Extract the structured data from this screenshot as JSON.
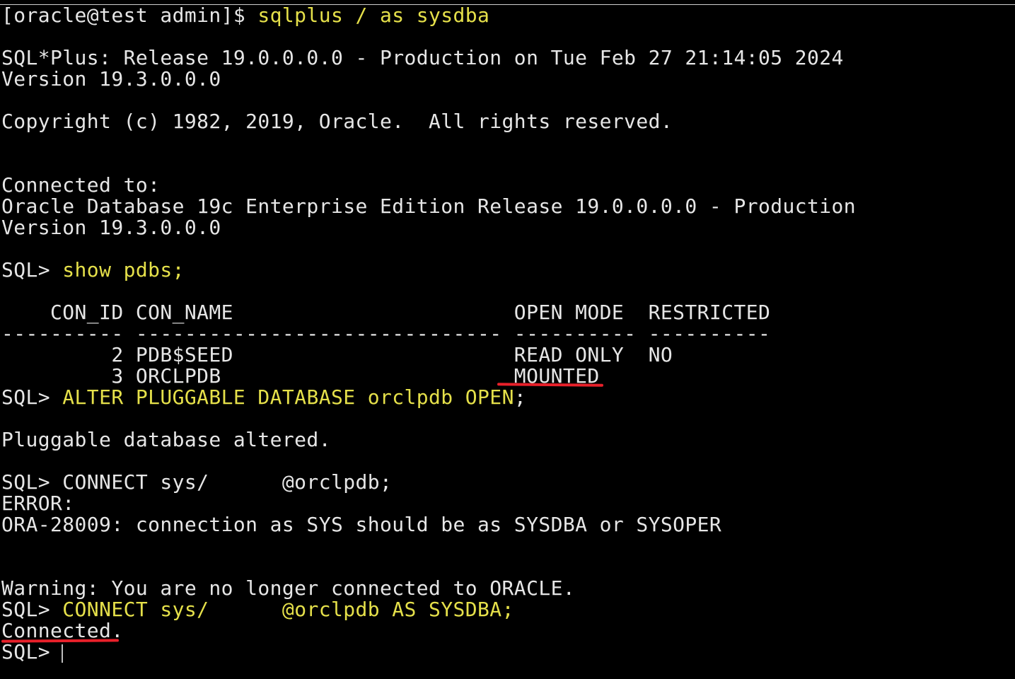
{
  "terminal": {
    "lines": [
      {
        "parts": [
          "[oracle@test admin]$ ",
          "sqlplus / as sysdba"
        ]
      },
      {
        "parts": [
          "SQL*Plus: Release 19.0.0.0.0 - Production on Tue Feb 27 21:14:05 2024"
        ]
      },
      {
        "parts": [
          "Version 19.3.0.0.0"
        ]
      },
      {
        "parts": [
          "Copyright (c) 1982, 2019, Oracle.  All rights reserved."
        ]
      },
      {
        "parts": [
          "Connected to:"
        ]
      },
      {
        "parts": [
          "Oracle Database 19c Enterprise Edition Release 19.0.0.0.0 - Production"
        ]
      },
      {
        "parts": [
          "Version 19.3.0.0.0"
        ]
      },
      {
        "parts": [
          "SQL> ",
          "show pdbs;"
        ]
      },
      {
        "parts": [
          "    CON_ID CON_NAME                       OPEN MODE  RESTRICTED"
        ]
      },
      {
        "parts": [
          "---------- ------------------------------ ---------- ----------"
        ]
      },
      {
        "parts": [
          "         2 PDB$SEED                       READ ONLY  NO"
        ]
      },
      {
        "parts": [
          "         3 ORCLPDB                        MOUNTED"
        ]
      },
      {
        "parts": [
          "SQL> ",
          "ALTER PLUGGABLE DATABASE orclpdb OPEN",
          ";"
        ]
      },
      {
        "parts": [
          "Pluggable database altered."
        ]
      },
      {
        "parts": [
          "SQL> CONNECT sys/      @orclpdb;"
        ]
      },
      {
        "parts": [
          "ERROR:"
        ]
      },
      {
        "parts": [
          "ORA-28009: connection as SYS should be as SYSDBA or SYSOPER"
        ]
      },
      {
        "parts": [
          "Warning: You are no longer connected to ORACLE."
        ]
      },
      {
        "parts": [
          "SQL> ",
          "CONNECT sys/      @orclpdb AS SYSDBA;"
        ]
      },
      {
        "parts": [
          "Connected."
        ]
      },
      {
        "parts": [
          "SQL> "
        ]
      }
    ]
  },
  "colors": {
    "background": "#000000",
    "text": "#e6e6e6",
    "command": "#e5e04a",
    "highlight_underline": "#e8202a"
  }
}
